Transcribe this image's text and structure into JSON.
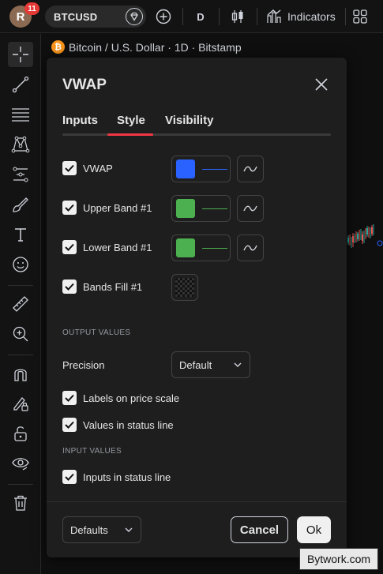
{
  "topbar": {
    "avatar_letter": "R",
    "notification_count": "11",
    "symbol": "BTCUSD",
    "interval": "D",
    "indicators_label": "Indicators"
  },
  "chart": {
    "legend_logo": "₿",
    "legend_title": "Bitcoin / U.S. Dollar · 1D · Bitstamp"
  },
  "dialog": {
    "title": "VWAP",
    "tabs": [
      {
        "label": "Inputs",
        "active": false
      },
      {
        "label": "Style",
        "active": true
      },
      {
        "label": "Visibility",
        "active": false
      }
    ],
    "style_rows": [
      {
        "label": "VWAP",
        "checked": true,
        "color": "#2962ff",
        "line_color": "#2962ff"
      },
      {
        "label": "Upper Band #1",
        "checked": true,
        "color": "#4caf50",
        "line_color": "#4caf50"
      },
      {
        "label": "Lower Band #1",
        "checked": true,
        "color": "#4caf50",
        "line_color": "#4caf50"
      }
    ],
    "bands_fill": {
      "label": "Bands Fill #1",
      "checked": true
    },
    "output_values_title": "OUTPUT VALUES",
    "precision_label": "Precision",
    "precision_value": "Default",
    "labels_on_price_scale": {
      "label": "Labels on price scale",
      "checked": true
    },
    "values_in_status_line": {
      "label": "Values in status line",
      "checked": true
    },
    "input_values_title": "INPUT VALUES",
    "inputs_in_status_line": {
      "label": "Inputs in status line",
      "checked": true
    },
    "defaults_label": "Defaults",
    "cancel_label": "Cancel",
    "ok_label": "Ok"
  },
  "watermark": "Bytwork.com",
  "colors": {
    "accent_red": "#f23645",
    "vwap_blue": "#2962ff",
    "band_green": "#4caf50"
  },
  "icons": [
    "crosshair-icon",
    "trend-line-icon",
    "fib-icon",
    "pattern-icon",
    "forecast-icon",
    "brush-icon",
    "text-icon",
    "emoji-icon",
    "ruler-icon",
    "zoom-in-icon",
    "magnet-icon",
    "lock-drawings-icon",
    "unlock-icon",
    "eye-icon",
    "trash-icon",
    "close-icon",
    "checkmark-icon",
    "line-style-icon",
    "chevron-down-icon",
    "plus-icon",
    "candles-icon",
    "indicators-icon",
    "layout-grid-icon"
  ]
}
